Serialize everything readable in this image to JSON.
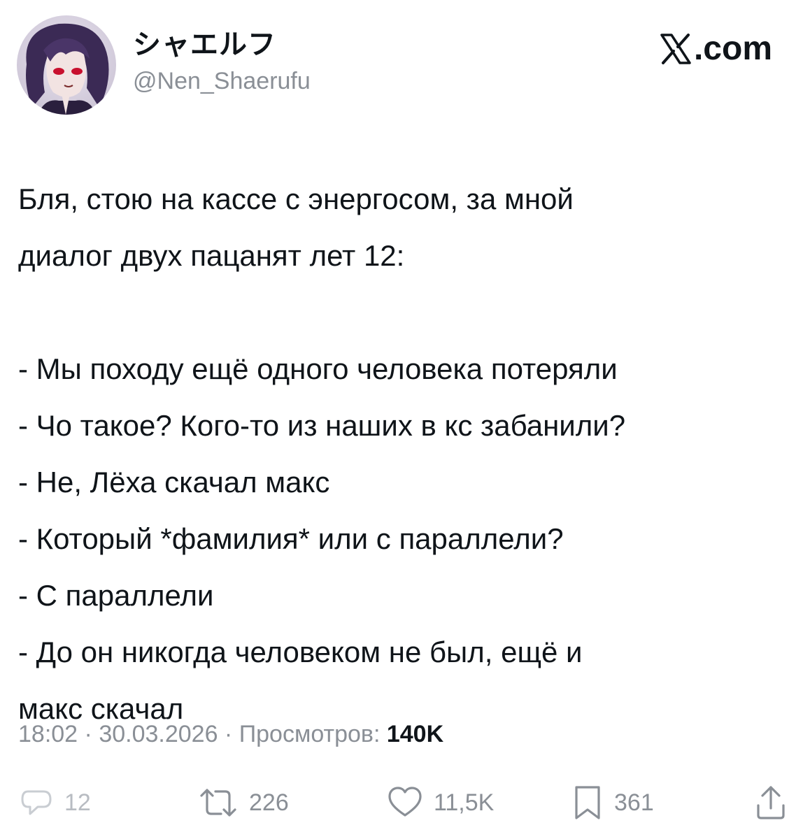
{
  "author": {
    "display_name": "シャエルフ",
    "handle": "@Nen_Shaerufu",
    "avatar_icon": "anime-character-avatar"
  },
  "brand": {
    "icon": "x-logo-icon",
    "text": ".com"
  },
  "tweet": {
    "lines": [
      "Бля, стою на кассе с энергосом, за мной",
      "диалог двух пацанят лет 12:",
      "",
      "- Мы походу ещё одного человека потеряли",
      "- Чо такое? Кого-то из наших в кс забанили?",
      "- Не, Лёха скачал макс",
      "- Который *фамилия* или с параллели?",
      "- С параллели",
      "- До он никогда человеком не был, ещё и",
      "макс скачал"
    ]
  },
  "meta": {
    "time": "18:02",
    "separator": " · ",
    "date": "30.03.2026",
    "views_label": "Просмотров: ",
    "views_count": "140K"
  },
  "actions": {
    "reply": {
      "icon": "reply-icon",
      "count": "12"
    },
    "repost": {
      "icon": "repost-icon",
      "count": "226"
    },
    "like": {
      "icon": "heart-icon",
      "count": "11,5K"
    },
    "bookmark": {
      "icon": "bookmark-icon",
      "count": "361"
    },
    "share": {
      "icon": "share-icon"
    }
  },
  "colors": {
    "text": "#0f1419",
    "secondary": "#8a8f96",
    "background": "#ffffff"
  }
}
